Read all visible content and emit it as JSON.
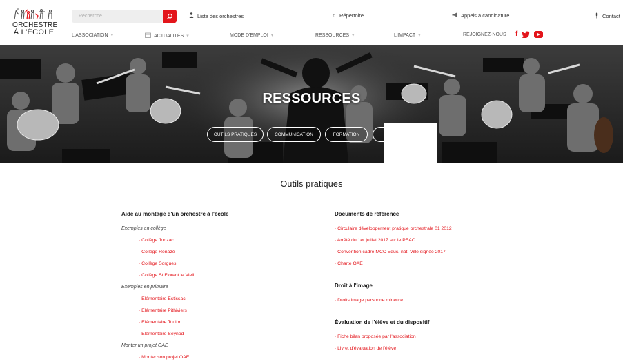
{
  "logo": {
    "line1": "ORCHESTRE",
    "line2": "À L'ÉCOLE",
    "colors": {
      "accent": "#e3151b"
    }
  },
  "search": {
    "placeholder": "Recherche"
  },
  "toplinks": [
    {
      "label": "Liste des orchestres",
      "icon": "person-icon"
    },
    {
      "label": "Répertoire",
      "icon": "music-note-icon"
    },
    {
      "label": "Appels à candidature",
      "icon": "megaphone-icon"
    },
    {
      "label": "Contact",
      "icon": "microphone-icon"
    }
  ],
  "nav": [
    {
      "label": "L'ASSOCIATION"
    },
    {
      "label": "ACTUALITÉS",
      "icon": "calendar-icon"
    },
    {
      "label": "MODE D'EMPLOI"
    },
    {
      "label": "RESSOURCES"
    },
    {
      "label": "L'IMPACT"
    },
    {
      "label": "REJOIGNEZ-NOUS"
    }
  ],
  "social": {
    "facebook": "f",
    "twitter": "twitter-bird-icon",
    "youtube": "youtube-icon"
  },
  "hero": {
    "title": "RESSOURCES",
    "pills": [
      "OUTILS PRATIQUES",
      "COMMUNICATION",
      "FORMATION"
    ]
  },
  "main": {
    "title": "Outils pratiques",
    "left": {
      "heading": "Aide au montage d'un orchestre à l'école",
      "groups": [
        {
          "label": "Exemples en collège",
          "links": [
            "Collège Jonzac",
            "Collège Renazé",
            "Collège Sorgues",
            "Collège St Florent le Vieil"
          ]
        },
        {
          "label": "Exemples en primaire",
          "links": [
            "Elémentaire Estissac",
            "Elémentaire Pithiviers",
            "Elémentaire Toulon",
            "Elémentaire Seynod"
          ]
        },
        {
          "label": "Monter un projet OAE",
          "links": [
            "Monter son projet OAE"
          ]
        }
      ]
    },
    "right": {
      "sections": [
        {
          "heading": "Documents de référence",
          "links": [
            "Circulaire développement pratique orchestrale 01 2012",
            "Arrêté du 1er juillet 2017 sur le PEAC",
            "Convention cadre MCC Educ. nat. Ville signée 2017",
            "Charte OAE"
          ]
        },
        {
          "heading": "Droit à l'image",
          "links": [
            "Droits image personne mineure"
          ]
        },
        {
          "heading": "Évaluation de l'élève et du dispositif",
          "links": [
            "Fiche bilan proposée par l'association",
            "Livret d'évaluation de l'élève"
          ]
        }
      ]
    }
  }
}
